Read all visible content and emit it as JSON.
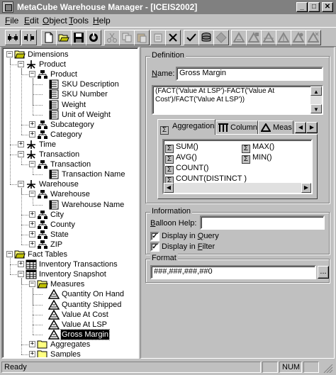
{
  "window": {
    "title": "MetaCube Warehouse Manager - [ICEIS2002]",
    "minimize": "_",
    "maximize": "□",
    "close": "✕"
  },
  "menu": [
    {
      "label": "File"
    },
    {
      "label": "Edit"
    },
    {
      "label": "Object"
    },
    {
      "label": "Tools"
    },
    {
      "label": "Help"
    }
  ],
  "toolbar": {
    "icons": [
      "connect-icon",
      "disconnect-icon",
      "new-icon",
      "open-icon",
      "save-icon",
      "refresh-icon",
      "cut-icon",
      "copy-icon",
      "paste-icon",
      "paste-special-icon",
      "delete-icon",
      "check-icon",
      "database-icon",
      "diamond-icon",
      "measure1-icon",
      "measure2-icon",
      "measure3-icon",
      "measure4-icon",
      "measure5-icon",
      "measure6-icon"
    ]
  },
  "tree": {
    "nodes": [
      {
        "label": "Dimensions",
        "icon": "folder-open-icon",
        "expander": "−"
      },
      {
        "label": "Product",
        "icon": "dimension-icon",
        "expander": "−"
      },
      {
        "label": "Product",
        "icon": "hierarchy-icon",
        "expander": "−"
      },
      {
        "label": "SKU Description",
        "icon": "attribute-icon"
      },
      {
        "label": "SKU Number",
        "icon": "attribute-icon"
      },
      {
        "label": "Weight",
        "icon": "attribute-icon"
      },
      {
        "label": "Unit of Weight",
        "icon": "attribute-icon"
      },
      {
        "label": "Subcategory",
        "icon": "hierarchy-icon",
        "expander": "+"
      },
      {
        "label": "Category",
        "icon": "hierarchy-icon",
        "expander": "+"
      },
      {
        "label": "Time",
        "icon": "dimension-icon",
        "expander": "+"
      },
      {
        "label": "Transaction",
        "icon": "dimension-icon",
        "expander": "−"
      },
      {
        "label": "Transaction",
        "icon": "hierarchy-icon",
        "expander": "−"
      },
      {
        "label": "Transaction Name",
        "icon": "attribute-icon"
      },
      {
        "label": "Warehouse",
        "icon": "dimension-icon",
        "expander": "−"
      },
      {
        "label": "Warehouse",
        "icon": "hierarchy-icon",
        "expander": "−"
      },
      {
        "label": "Warehouse Name",
        "icon": "attribute-icon"
      },
      {
        "label": "City",
        "icon": "hierarchy-icon",
        "expander": "+"
      },
      {
        "label": "County",
        "icon": "hierarchy-icon",
        "expander": "+"
      },
      {
        "label": "State",
        "icon": "hierarchy-icon",
        "expander": "+"
      },
      {
        "label": "ZIP",
        "icon": "hierarchy-icon",
        "expander": "+"
      },
      {
        "label": "Fact Tables",
        "icon": "folder-open-icon",
        "expander": "−"
      },
      {
        "label": "Inventory Transactions",
        "icon": "table-icon",
        "expander": "+"
      },
      {
        "label": "Inventory Snapshot",
        "icon": "table-icon",
        "expander": "−"
      },
      {
        "label": "Measures",
        "icon": "folder-open-icon",
        "expander": "−"
      },
      {
        "label": "Quantity On Hand",
        "icon": "measure-icon"
      },
      {
        "label": "Quantity Shipped",
        "icon": "measure-icon"
      },
      {
        "label": "Value At Cost",
        "icon": "measure-icon"
      },
      {
        "label": "Value At LSP",
        "icon": "measure-icon"
      },
      {
        "label": "Gross Margin",
        "icon": "measure-icon",
        "selected": true
      },
      {
        "label": "Aggregates",
        "icon": "folder-icon",
        "expander": "+"
      },
      {
        "label": "Samples",
        "icon": "folder-icon",
        "expander": "+"
      }
    ]
  },
  "definition": {
    "group_title": "Definition",
    "name_label": "Name:",
    "name_value": "Gross Margin",
    "expr_line1": "(FACT('Value At LSP')-FACT('Value At",
    "expr_line2": "Cost')/FACT('Value At LSP'))",
    "tabs": [
      {
        "label": "Aggregations",
        "active": true
      },
      {
        "label": "Columns"
      },
      {
        "label": "Meas"
      }
    ],
    "aggregations": [
      {
        "label": "SUM()",
        "icon": "sigma-icon"
      },
      {
        "label": "AVG()",
        "icon": "sigma-icon"
      },
      {
        "label": "COUNT()",
        "icon": "sigma-icon"
      },
      {
        "label": "COUNT(DISTINCT )",
        "icon": "sigma-icon"
      },
      {
        "label": "MAX()",
        "icon": "sigma-icon"
      },
      {
        "label": "MIN()",
        "icon": "sigma-icon"
      }
    ]
  },
  "information": {
    "group_title": "Information",
    "balloon_label": "Balloon Help:",
    "balloon_value": "",
    "display_query": "Display in Query",
    "display_query_checked": true,
    "display_filter": "Display in Filter",
    "display_filter_checked": true
  },
  "format": {
    "group_title": "Format",
    "value": "###,###,###,##0",
    "browse": "..."
  },
  "status": {
    "text": "Ready",
    "num": "NUM"
  }
}
